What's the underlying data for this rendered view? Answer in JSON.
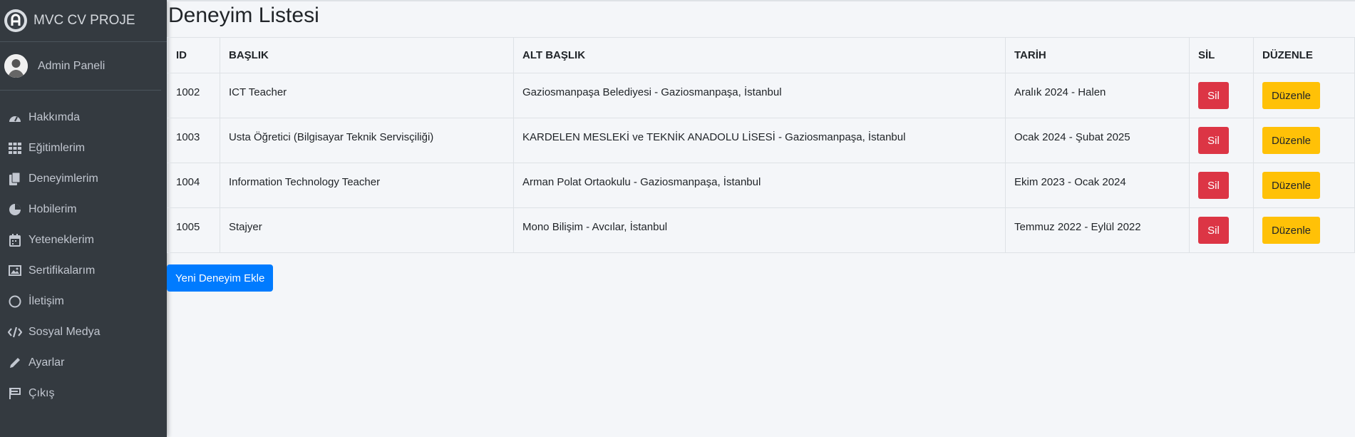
{
  "sidebar": {
    "brand": "MVC CV PROJE",
    "user": "Admin Paneli",
    "items": [
      {
        "label": "Hakkımda",
        "icon": "dashboard-gauge-icon"
      },
      {
        "label": "Eğitimlerim",
        "icon": "grid-icon"
      },
      {
        "label": "Deneyimlerim",
        "icon": "copy-file-icon"
      },
      {
        "label": "Hobilerim",
        "icon": "pie-chart-icon"
      },
      {
        "label": "Yeteneklerim",
        "icon": "calendar-icon"
      },
      {
        "label": "Sertifikalarım",
        "icon": "image-icon"
      },
      {
        "label": "İletişim",
        "icon": "circle-icon"
      },
      {
        "label": "Sosyal Medya",
        "icon": "code-icon"
      },
      {
        "label": "Ayarlar",
        "icon": "pencil-icon"
      },
      {
        "label": "Çıkış",
        "icon": "flag-icon"
      }
    ]
  },
  "main": {
    "title": "Deneyim Listesi",
    "table": {
      "headers": [
        "ID",
        "BAŞLIK",
        "ALT BAŞLIK",
        "TARİH",
        "SİL",
        "DÜZENLE"
      ],
      "rows": [
        {
          "id": "1002",
          "title": "ICT Teacher",
          "subtitle": "Gaziosmanpaşa Belediyesi - Gaziosmanpaşa, İstanbul",
          "date": "Aralık 2024 - Halen",
          "delete": "Sil",
          "edit": "Düzenle"
        },
        {
          "id": "1003",
          "title": "Usta Öğretici (Bilgisayar Teknik Servisçiliği)",
          "subtitle": "KARDELEN MESLEKİ ve TEKNİK ANADOLU LİSESİ - Gaziosmanpaşa, İstanbul",
          "date": "Ocak 2024 - Şubat 2025",
          "delete": "Sil",
          "edit": "Düzenle"
        },
        {
          "id": "1004",
          "title": "Information Technology Teacher",
          "subtitle": "Arman Polat Ortaokulu - Gaziosmanpaşa, İstanbul",
          "date": "Ekim 2023 - Ocak 2024",
          "delete": "Sil",
          "edit": "Düzenle"
        },
        {
          "id": "1005",
          "title": "Stajyer",
          "subtitle": "Mono Bilişim - Avcılar, İstanbul",
          "date": "Temmuz 2022 - Eylül 2022",
          "delete": "Sil",
          "edit": "Düzenle"
        }
      ]
    },
    "add_button": "Yeni Deneyim Ekle"
  },
  "colors": {
    "sidebar_bg": "#343a40",
    "danger": "#dc3545",
    "warning": "#ffc107",
    "primary": "#007bff"
  }
}
